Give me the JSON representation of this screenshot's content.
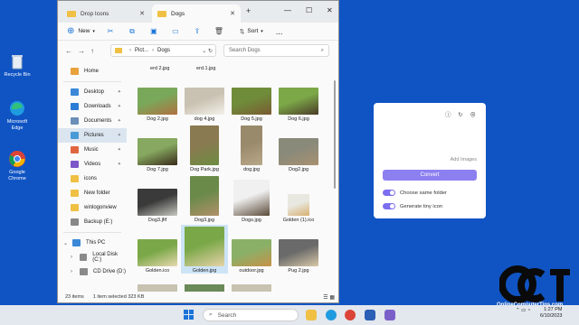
{
  "desktop": {
    "icons": [
      {
        "label": "Recycle Bin",
        "icon": "recycle-bin-icon"
      },
      {
        "label": "Microsoft Edge",
        "icon": "edge-icon"
      },
      {
        "label": "Google Chrome",
        "icon": "chrome-icon"
      }
    ]
  },
  "explorer": {
    "tabs": [
      {
        "label": "Drop Icons",
        "active": false
      },
      {
        "label": "Dogs",
        "active": true
      }
    ],
    "toolbar": {
      "new_label": "New",
      "sort_label": "Sort",
      "more_label": "..."
    },
    "address": {
      "crumb1": "Pict...",
      "crumb2": "Dogs",
      "search_placeholder": "Search Dogs"
    },
    "sidebar": {
      "home": "Home",
      "pinned": [
        {
          "label": "Desktop",
          "color": "#3b88d8"
        },
        {
          "label": "Downloads",
          "color": "#2a7dd6"
        },
        {
          "label": "Documents",
          "color": "#6c8fb8"
        },
        {
          "label": "Pictures",
          "color": "#4a9ad8"
        },
        {
          "label": "Music",
          "color": "#e0663f"
        },
        {
          "label": "Videos",
          "color": "#7d56c8"
        }
      ],
      "folders": [
        "icons",
        "New folder",
        "winlogonview",
        "Backup (E:)"
      ],
      "tree": [
        "This PC",
        "Local Disk (C:)",
        "CD Drive (D:)"
      ]
    },
    "files_top_partial": [
      "erd 2.jpg",
      "erd.1.jpg"
    ],
    "files": [
      {
        "name": "Dog 2.jpg",
        "c1": "#7aa85a",
        "c2": "#b07040"
      },
      {
        "name": "dog 4.jpg",
        "c1": "#c9c2b2",
        "c2": "#f4f1ea"
      },
      {
        "name": "Dog 5.jpg",
        "c1": "#6f8c3a",
        "c2": "#7a5a32"
      },
      {
        "name": "Dog 6.jpg",
        "c1": "#7ca848",
        "c2": "#4a3a28"
      },
      {
        "name": "Dog 7.jpg",
        "c1": "#86a860",
        "c2": "#3a2a1a"
      },
      {
        "name": "Dog Park.jpg",
        "c1": "#8a7a52",
        "c2": "#6c8c40"
      },
      {
        "name": "dog.jpg",
        "c1": "#9a8a6c",
        "c2": "#b8a888"
      },
      {
        "name": "Dog2.jpg",
        "c1": "#8a8a7a",
        "c2": "#a89070"
      },
      {
        "name": "Dog3.jfif",
        "c1": "#3a3a3a",
        "c2": "#c8c8c0"
      },
      {
        "name": "Dog3.jpg",
        "c1": "#6a8a4a",
        "c2": "#b09068"
      },
      {
        "name": "Dogs.jpg",
        "c1": "#f0f0f0",
        "c2": "#5a4a38"
      },
      {
        "name": "Golden (1).ico",
        "c1": "#e8e8e0",
        "c2": "#d8b070"
      },
      {
        "name": "Golden.ico",
        "c1": "#7aa848",
        "c2": "#e8d8b0"
      },
      {
        "name": "Golden.jpg",
        "c1": "#7aa848",
        "c2": "#e6d2a8"
      },
      {
        "name": "outdoor.jpg",
        "c1": "#8ab068",
        "c2": "#c89048"
      },
      {
        "name": "Pug 2.jpg",
        "c1": "#6a6a6a",
        "c2": "#d8c8a8"
      }
    ],
    "status": {
      "items": "23 items",
      "selected": "1 item selected  323 KB"
    }
  },
  "dialog": {
    "add_images": "Add Images",
    "convert": "Convert",
    "option1": "Choose same folder",
    "option2": "Generate tiny icon"
  },
  "watermark": {
    "logo": "OCT",
    "text": "OnlineComputerTips.com"
  },
  "taskbar": {
    "search": "Search",
    "time": "1:27 PM",
    "date": "6/10/2023"
  }
}
